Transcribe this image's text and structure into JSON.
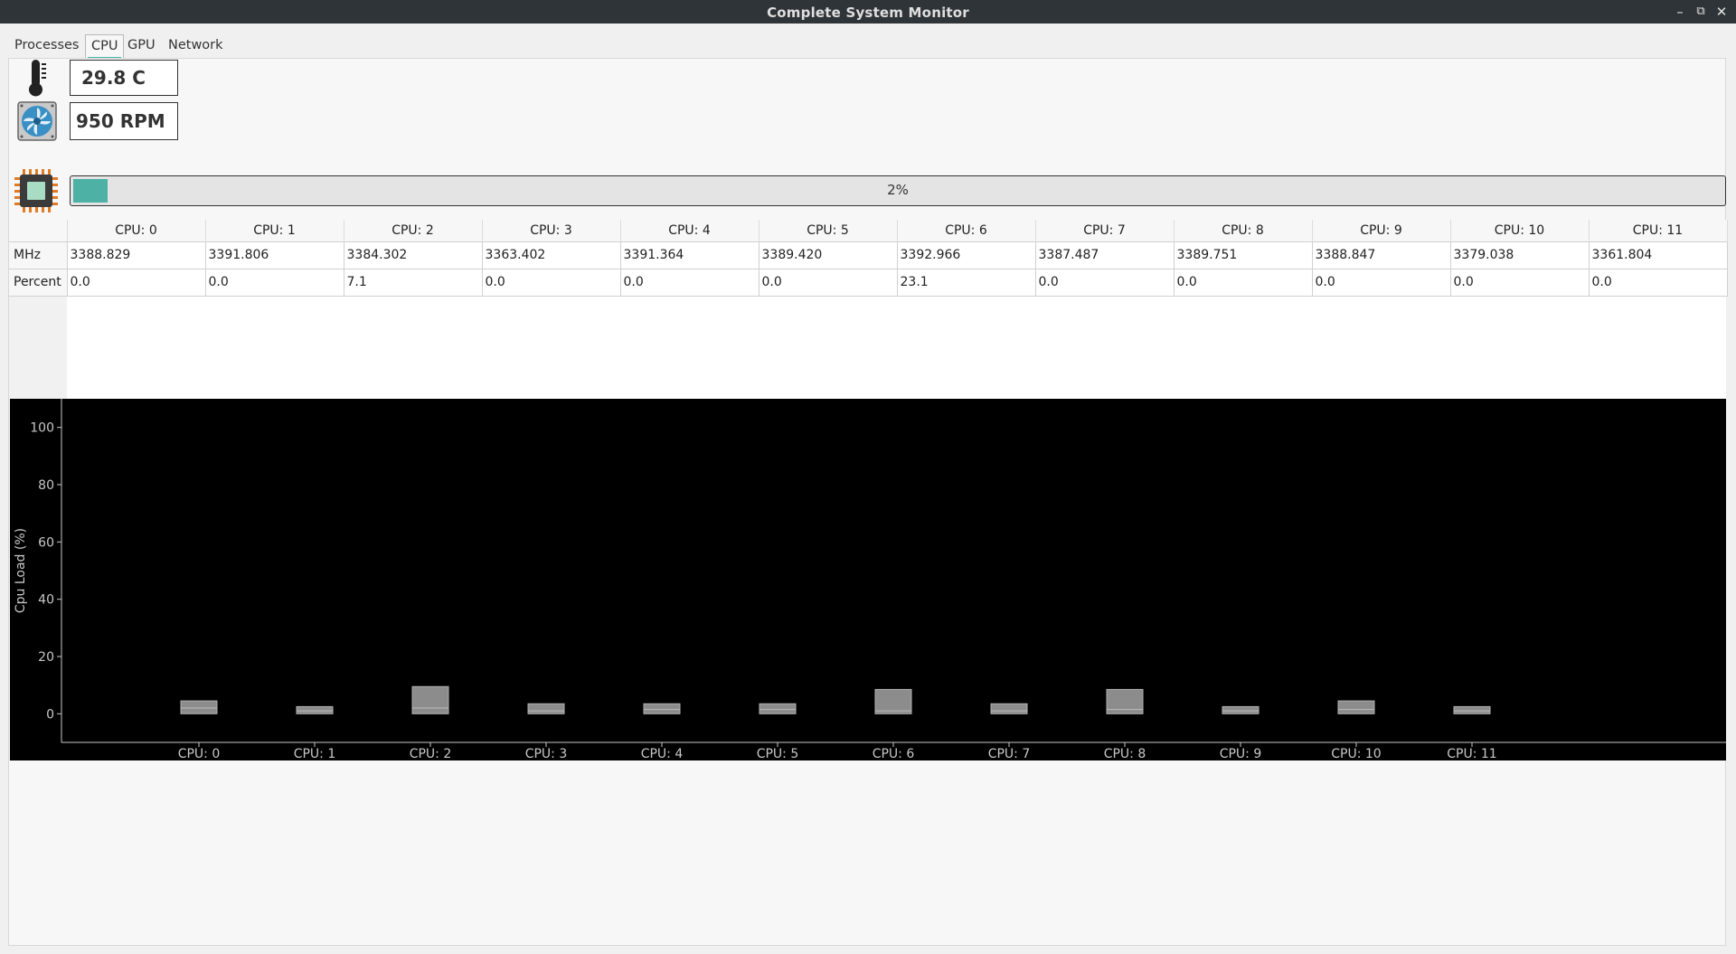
{
  "window": {
    "title": "Complete System Monitor"
  },
  "window_controls": {
    "minimize": "–",
    "maximize": "⧉",
    "close": "✕"
  },
  "tabs": [
    {
      "label": "Processes",
      "active": false
    },
    {
      "label": "CPU",
      "active": true
    },
    {
      "label": "GPU",
      "active": false
    },
    {
      "label": "Network",
      "active": false
    }
  ],
  "sensors": {
    "temperature": "29.8 C",
    "fan": "950 RPM"
  },
  "cpu_usage": {
    "percent": 2,
    "label": "2%"
  },
  "table": {
    "headers": [
      "CPU: 0",
      "CPU: 1",
      "CPU: 2",
      "CPU: 3",
      "CPU: 4",
      "CPU: 5",
      "CPU: 6",
      "CPU: 7",
      "CPU: 8",
      "CPU: 9",
      "CPU: 10",
      "CPU: 11"
    ],
    "rows": [
      {
        "label": "MHz",
        "values": [
          "3388.829",
          "3391.806",
          "3384.302",
          "3363.402",
          "3391.364",
          "3389.420",
          "3392.966",
          "3387.487",
          "3389.751",
          "3388.847",
          "3379.038",
          "3361.804"
        ]
      },
      {
        "label": "Percent",
        "values": [
          "0.0",
          "0.0",
          "7.1",
          "0.0",
          "0.0",
          "0.0",
          "23.1",
          "0.0",
          "0.0",
          "0.0",
          "0.0",
          "0.0"
        ]
      }
    ]
  },
  "chart_data": {
    "type": "bar",
    "ylabel": "Cpu Load (%)",
    "ylim": [
      -10,
      110
    ],
    "yticks": [
      0,
      20,
      40,
      60,
      80,
      100
    ],
    "categories": [
      "CPU: 0",
      "CPU: 1",
      "CPU: 2",
      "CPU: 3",
      "CPU: 4",
      "CPU: 5",
      "CPU: 6",
      "CPU: 7",
      "CPU: 8",
      "CPU: 9",
      "CPU: 10",
      "CPU: 11"
    ],
    "boxes": [
      {
        "low": 0,
        "high": 4.5,
        "mid": 2
      },
      {
        "low": 0,
        "high": 2.5,
        "mid": 1
      },
      {
        "low": 0,
        "high": 9.5,
        "mid": 2
      },
      {
        "low": 0,
        "high": 3.5,
        "mid": 1
      },
      {
        "low": 0,
        "high": 3.5,
        "mid": 1.5
      },
      {
        "low": 0,
        "high": 3.5,
        "mid": 1.5
      },
      {
        "low": 0,
        "high": 8.5,
        "mid": 1
      },
      {
        "low": 0,
        "high": 3.5,
        "mid": 1
      },
      {
        "low": 0,
        "high": 8.5,
        "mid": 1.5
      },
      {
        "low": 0,
        "high": 2.5,
        "mid": 1
      },
      {
        "low": 0,
        "high": 4.5,
        "mid": 1.5
      },
      {
        "low": 0,
        "high": 2.5,
        "mid": 1
      }
    ],
    "colors": {
      "background": "#000000",
      "box": "#8c8c8c",
      "axis": "#c8c8c8"
    },
    "grid": false
  },
  "colors": {
    "accent": "#45b6a8",
    "bar_fill": "#4db1a6"
  }
}
